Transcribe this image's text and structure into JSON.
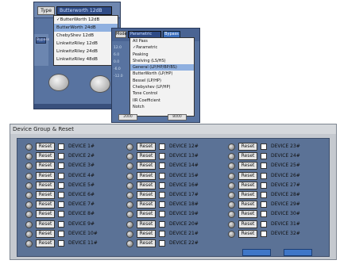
{
  "filter_type_shot": {
    "type_label": "Type",
    "selected_value": "Butterworth 12dB",
    "menu_items": [
      {
        "label": "ButterWorth 12dB",
        "checked": true
      },
      {
        "label": "ButterWorth 24dB",
        "selected": true
      },
      {
        "label": "ChebyShev 12dB"
      },
      {
        "label": "LinkwitzRiley 12dB"
      },
      {
        "label": "LinkwitzRiley 24dB"
      },
      {
        "label": "LinkwitzRiley 48dB"
      }
    ],
    "side_label": "Bypass"
  },
  "filter_mode_shot": {
    "mode_label": "Mode",
    "selected_value": "Parametric",
    "bypass_label": "Bypass",
    "menu_items": [
      {
        "label": "All Pass"
      },
      {
        "label": "Parametric",
        "checked": true
      },
      {
        "label": "Peaking"
      },
      {
        "label": "Shelving (LS/HS)"
      },
      {
        "label": "General (LP/HP/BP/BS)",
        "selected": true
      },
      {
        "label": "ButterWorth (LP/HP)"
      },
      {
        "label": "Bessel (LP/HP)"
      },
      {
        "label": "Chebyshev (LP/HP)"
      },
      {
        "label": "Tone Control"
      },
      {
        "label": "IIR Coefficient"
      },
      {
        "label": "Notch"
      }
    ],
    "scale": [
      "12.0",
      "6.0",
      "0.0",
      "-6.0",
      "-12.0"
    ],
    "bottom_values": [
      "2000",
      "8000"
    ]
  },
  "dialog": {
    "title": "Device Group & Reset",
    "reset_label": "Reset",
    "devices": [
      "DEVICE 1#",
      "DEVICE 2#",
      "DEVICE 3#",
      "DEVICE 4#",
      "DEVICE 5#",
      "DEVICE 6#",
      "DEVICE 7#",
      "DEVICE 8#",
      "DEVICE 9#",
      "DEVICE 10#",
      "DEVICE 11#",
      "DEVICE 12#",
      "DEVICE 13#",
      "DEVICE 14#",
      "DEVICE 15#",
      "DEVICE 16#",
      "DEVICE 17#",
      "DEVICE 18#",
      "DEVICE 19#",
      "DEVICE 20#",
      "DEVICE 21#",
      "DEVICE 22#",
      "DEVICE 23#",
      "DEVICE 24#",
      "DEVICE 25#",
      "DEVICE 26#",
      "DEVICE 27#",
      "DEVICE 28#",
      "DEVICE 29#",
      "DEVICE 30#",
      "DEVICE 31#",
      "DEVICE 32#"
    ]
  }
}
